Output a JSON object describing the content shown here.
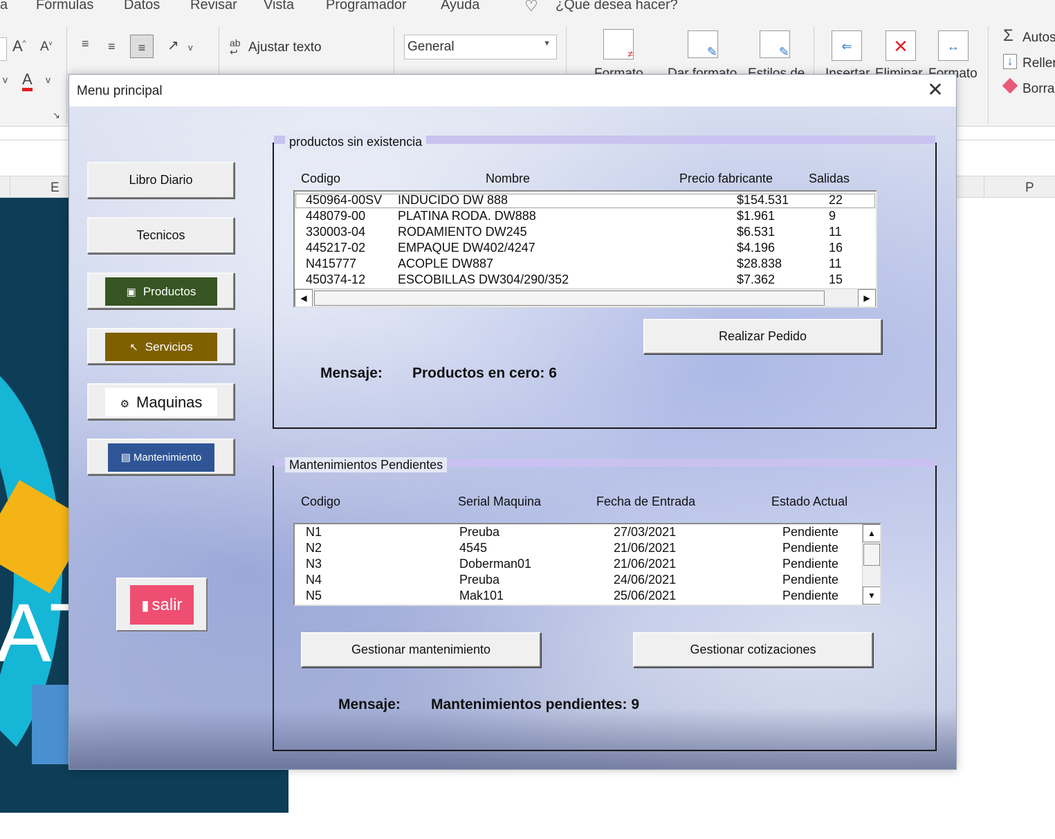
{
  "excel": {
    "tabs": [
      "a",
      "Fórmulas",
      "Datos",
      "Revisar",
      "Vista",
      "Programador",
      "Ayuda"
    ],
    "tell_me": "¿Qué desea hacer?",
    "wrap_text": "Ajustar texto",
    "number_format": "General",
    "cut_labels": [
      "Formato",
      "Dar formato",
      "Estilos de",
      "Insertar",
      "Eliminar",
      "Formato"
    ],
    "right_group": [
      "Autos",
      "Reller",
      "Borra"
    ],
    "columns": [
      "E",
      "P"
    ],
    "banner_text": "ATE"
  },
  "dialog": {
    "title": "Menu principal",
    "close_glyph": "✕",
    "side_buttons": {
      "libro_diario": "Libro Diario",
      "tecnicos": "Tecnicos",
      "productos": "Productos",
      "servicios": "Servicios",
      "maquinas": "Maquinas",
      "mantenimiento": "Mantenimiento",
      "salir": "salir"
    },
    "products": {
      "caption": "productos sin existencia",
      "headers": [
        "Codigo",
        "Nombre",
        "Precio fabricante",
        "Salidas"
      ],
      "rows": [
        {
          "codigo": "450964-00SV",
          "nombre": "INDUCIDO DW 888",
          "precio": "$154.531",
          "salidas": "22"
        },
        {
          "codigo": "448079-00",
          "nombre": "PLATINA RODA. DW888",
          "precio": "$1.961",
          "salidas": "9"
        },
        {
          "codigo": "330003-04",
          "nombre": "RODAMIENTO DW245",
          "precio": "$6.531",
          "salidas": "11"
        },
        {
          "codigo": "445217-02",
          "nombre": "EMPAQUE DW402/4247",
          "precio": "$4.196",
          "salidas": "16"
        },
        {
          "codigo": "N415777",
          "nombre": "ACOPLE DW887",
          "precio": "$28.838",
          "salidas": "11"
        },
        {
          "codigo": "450374-12",
          "nombre": "ESCOBILLAS DW304/290/352",
          "precio": "$7.362",
          "salidas": "15"
        }
      ],
      "order_button": "Realizar Pedido",
      "message_label": "Mensaje:",
      "message_text": "Productos en cero: 6"
    },
    "maintenance": {
      "caption": "Mantenimientos Pendientes",
      "headers": [
        "Codigo",
        "Serial Maquina",
        "Fecha de Entrada",
        "Estado Actual"
      ],
      "rows": [
        {
          "codigo": "N1",
          "serial": "Preuba",
          "fecha": "27/03/2021",
          "estado": "Pendiente"
        },
        {
          "codigo": "N2",
          "serial": "4545",
          "fecha": "21/06/2021",
          "estado": "Pendiente"
        },
        {
          "codigo": "N3",
          "serial": "Doberman01",
          "fecha": "21/06/2021",
          "estado": "Pendiente"
        },
        {
          "codigo": "N4",
          "serial": "Preuba",
          "fecha": "24/06/2021",
          "estado": "Pendiente"
        },
        {
          "codigo": "N5",
          "serial": "Mak101",
          "fecha": "25/06/2021",
          "estado": "Pendiente"
        }
      ],
      "manage_button": "Gestionar mantenimiento",
      "quotes_button": "Gestionar cotizaciones",
      "message_label": "Mensaje:",
      "message_text": "Mantenimientos pendientes: 9"
    }
  },
  "colors": {
    "productos_bg": "#375623",
    "servicios_bg": "#7f6000",
    "mantenimiento_bg": "#2f5597",
    "salir_bg": "#ee4e72"
  }
}
